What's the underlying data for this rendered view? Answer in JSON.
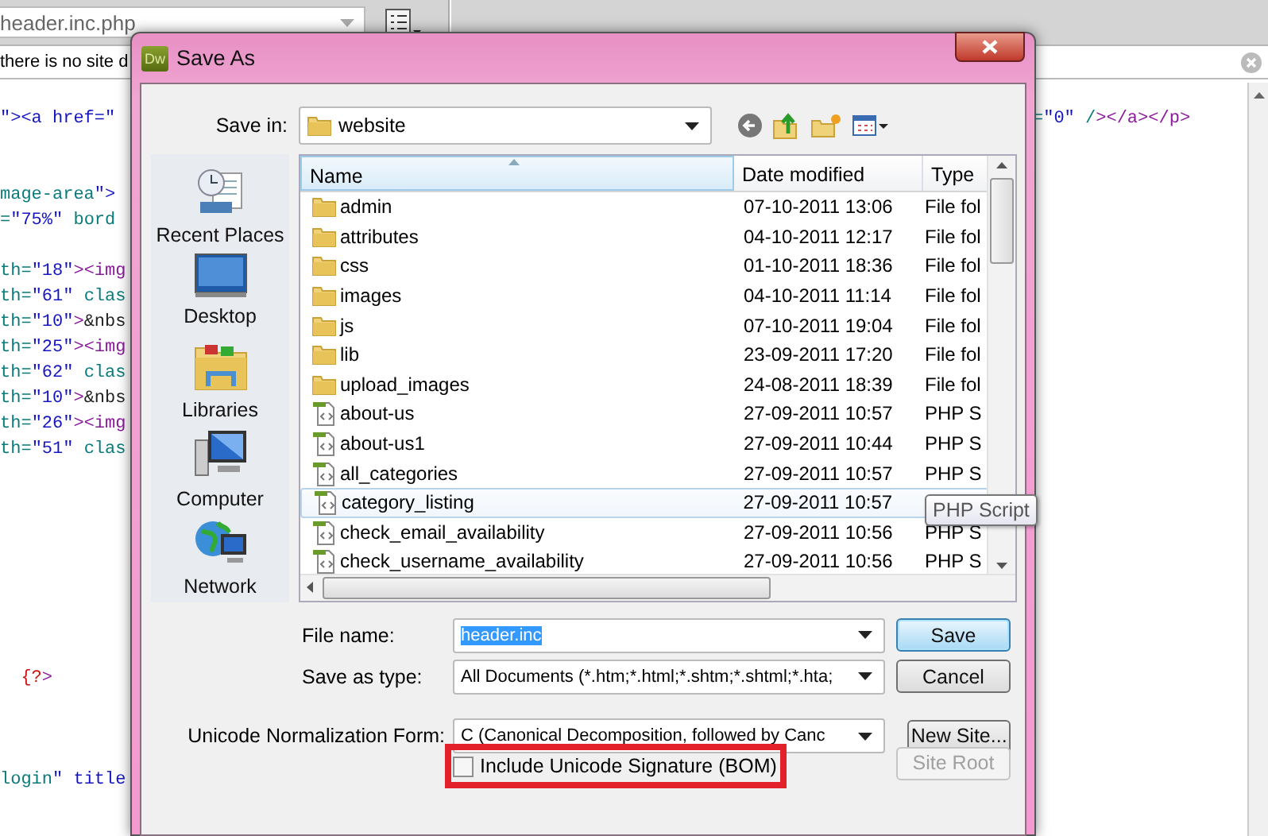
{
  "editor": {
    "document_field": {
      "value": "header.inc.php"
    },
    "info_bar": {
      "text": "there is no site d"
    },
    "code_lines": [
      {
        "text": "\"><a href=\""
      },
      {
        "text": "mage-area\">"
      },
      {
        "text": "=\"75%\" bord"
      },
      {
        "text": "th=\"18\"><img"
      },
      {
        "text": "th=\"61\" clas"
      },
      {
        "text": "th=\"10\">&nbs"
      },
      {
        "text": "th=\"25\"><img"
      },
      {
        "text": "th=\"62\" clas"
      },
      {
        "text": "th=\"10\">&nbs"
      },
      {
        "text": "th=\"26\"><img"
      },
      {
        "text": "th=\"51\" clas"
      },
      {
        "text": "  {?>"
      },
      {
        "text": "login\" title"
      }
    ],
    "code_right": {
      "text": "=\"0\" /></a></p>"
    }
  },
  "dialog": {
    "app_icon_text": "Dw",
    "title": "Save As",
    "save_in": {
      "label": "Save in:",
      "value": "website"
    },
    "places": [
      {
        "label": "Recent Places",
        "kind": "recent"
      },
      {
        "label": "Desktop",
        "kind": "desktop"
      },
      {
        "label": "Libraries",
        "kind": "libraries"
      },
      {
        "label": "Computer",
        "kind": "computer"
      },
      {
        "label": "Network",
        "kind": "network"
      }
    ],
    "file_list": {
      "columns": [
        "Name",
        "Date modified",
        "Type"
      ],
      "rows": [
        {
          "name": "admin",
          "kind": "folder",
          "date": "07-10-2011 13:06",
          "type": "File fol",
          "highlighted": false
        },
        {
          "name": "attributes",
          "kind": "folder",
          "date": "04-10-2011 12:17",
          "type": "File fol",
          "highlighted": false
        },
        {
          "name": "css",
          "kind": "folder",
          "date": "01-10-2011 18:36",
          "type": "File fol",
          "highlighted": false
        },
        {
          "name": "images",
          "kind": "folder",
          "date": "04-10-2011 11:14",
          "type": "File fol",
          "highlighted": false
        },
        {
          "name": "js",
          "kind": "folder",
          "date": "07-10-2011 19:04",
          "type": "File fol",
          "highlighted": false
        },
        {
          "name": "lib",
          "kind": "folder",
          "date": "23-09-2011 17:20",
          "type": "File fol",
          "highlighted": false
        },
        {
          "name": "upload_images",
          "kind": "folder",
          "date": "24-08-2011 18:39",
          "type": "File fol",
          "highlighted": false
        },
        {
          "name": "about-us",
          "kind": "php",
          "date": "27-09-2011 10:57",
          "type": "PHP S",
          "highlighted": false
        },
        {
          "name": "about-us1",
          "kind": "php",
          "date": "27-09-2011 10:44",
          "type": "PHP S",
          "highlighted": false
        },
        {
          "name": "all_categories",
          "kind": "php",
          "date": "27-09-2011 10:57",
          "type": "PHP S",
          "highlighted": false
        },
        {
          "name": "category_listing",
          "kind": "php",
          "date": "27-09-2011 10:57",
          "highlighted": true
        },
        {
          "name": "check_email_availability",
          "kind": "php",
          "date": "27-09-2011 10:56",
          "type": "PHP S",
          "highlighted": false
        },
        {
          "name": "check_username_availability",
          "kind": "php",
          "date": "27-09-2011 10:56",
          "type": "PHP S",
          "highlighted": false
        }
      ],
      "tooltip": "PHP Script"
    },
    "file_name": {
      "label": "File name:",
      "value": "header.inc"
    },
    "save_as_type": {
      "label": "Save as type:",
      "value": "All Documents (*.htm;*.html;*.shtm;*.shtml;*.hta;"
    },
    "normalization": {
      "label": "Unicode Normalization Form:",
      "value": "C (Canonical Decomposition, followed by Canc"
    },
    "bom": {
      "label": "Include Unicode Signature (BOM)",
      "checked": false
    },
    "buttons": [
      {
        "label": "Save",
        "kind": "default",
        "disabled": false
      },
      {
        "label": "Cancel",
        "kind": "normal",
        "disabled": false
      },
      {
        "label": "New Site...",
        "kind": "normal",
        "disabled": false
      },
      {
        "label": "Site Root",
        "kind": "normal",
        "disabled": true
      }
    ]
  }
}
